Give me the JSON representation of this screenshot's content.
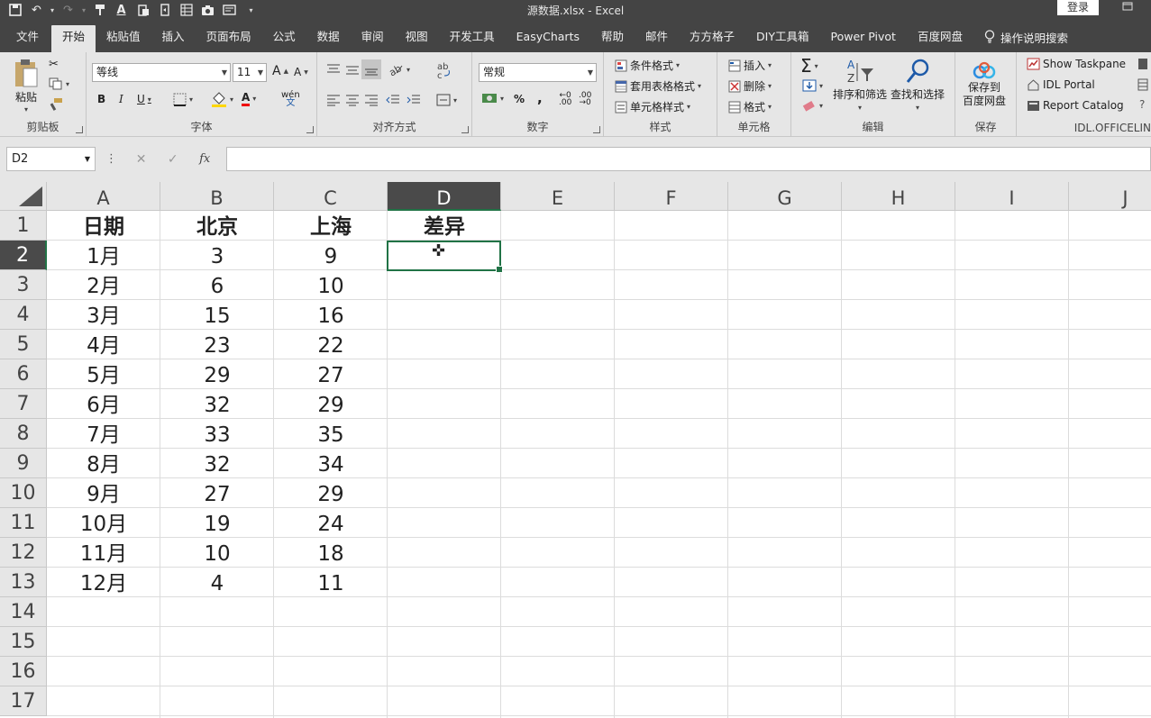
{
  "app": {
    "title": "源数据.xlsx  -  Excel",
    "login": "登录"
  },
  "qat": [
    "save-icon",
    "undo-icon",
    "redo-icon",
    "format-painter-icon",
    "font-color-icon",
    "paste-icon",
    "form-icon",
    "table-icon",
    "camera-icon",
    "screen-icon",
    "customize-icon"
  ],
  "tabs": [
    "文件",
    "开始",
    "粘贴值",
    "插入",
    "页面布局",
    "公式",
    "数据",
    "审阅",
    "视图",
    "开发工具",
    "EasyCharts",
    "帮助",
    "邮件",
    "方方格子",
    "DIY工具箱",
    "Power Pivot",
    "百度网盘"
  ],
  "active_tab": "开始",
  "tell_me": "操作说明搜索",
  "ribbon": {
    "clipboard": {
      "label": "剪贴板",
      "paste": "粘贴"
    },
    "font": {
      "label": "字体",
      "name": "等线",
      "size": "11",
      "bold": "B",
      "italic": "I",
      "underline": "U",
      "grow": "A",
      "shrink": "A",
      "color_letter": "A",
      "wen": "wén"
    },
    "alignment": {
      "label": "对齐方式"
    },
    "number": {
      "label": "数字",
      "format": "常规",
      "percent": "%",
      "comma": ","
    },
    "styles": {
      "label": "样式",
      "conditional": "条件格式",
      "table": "套用表格格式",
      "cell": "单元格样式"
    },
    "cells": {
      "label": "单元格",
      "insert": "插入",
      "delete": "删除",
      "format": "格式"
    },
    "editing": {
      "label": "编辑",
      "sort": "排序和筛选",
      "find": "查找和选择",
      "sigma": "Σ"
    },
    "save": {
      "label": "保存",
      "btn1": "保存到",
      "btn2": "百度网盘"
    },
    "idl": {
      "label": "IDL.OFFICELIN",
      "taskpane": "Show Taskpane",
      "portal": "IDL Portal",
      "catalog": "Report Catalog"
    }
  },
  "formula_bar": {
    "name_box": "D2",
    "formula": "",
    "fx": "fx",
    "cancel": "✕",
    "enter": "✓",
    "sep": "⋮"
  },
  "columns": [
    "A",
    "B",
    "C",
    "D",
    "E",
    "F",
    "G",
    "H",
    "I",
    "J"
  ],
  "selected_column": "D",
  "selected_row": "2",
  "rows": [
    "1",
    "2",
    "3",
    "4",
    "5",
    "6",
    "7",
    "8",
    "9",
    "10",
    "11",
    "12",
    "13",
    "14",
    "15",
    "16",
    "17"
  ],
  "headers": [
    "日期",
    "北京",
    "上海",
    "差异"
  ],
  "data": [
    [
      "1月",
      "3",
      "9"
    ],
    [
      "2月",
      "6",
      "10"
    ],
    [
      "3月",
      "15",
      "16"
    ],
    [
      "4月",
      "23",
      "22"
    ],
    [
      "5月",
      "29",
      "27"
    ],
    [
      "6月",
      "32",
      "29"
    ],
    [
      "7月",
      "33",
      "35"
    ],
    [
      "8月",
      "32",
      "34"
    ],
    [
      "9月",
      "27",
      "29"
    ],
    [
      "10月",
      "19",
      "24"
    ],
    [
      "11月",
      "10",
      "18"
    ],
    [
      "12月",
      "4",
      "11"
    ]
  ],
  "colors": {
    "accent": "#217346",
    "titlebar": "#444444",
    "ribbon": "#e6e6e6"
  }
}
